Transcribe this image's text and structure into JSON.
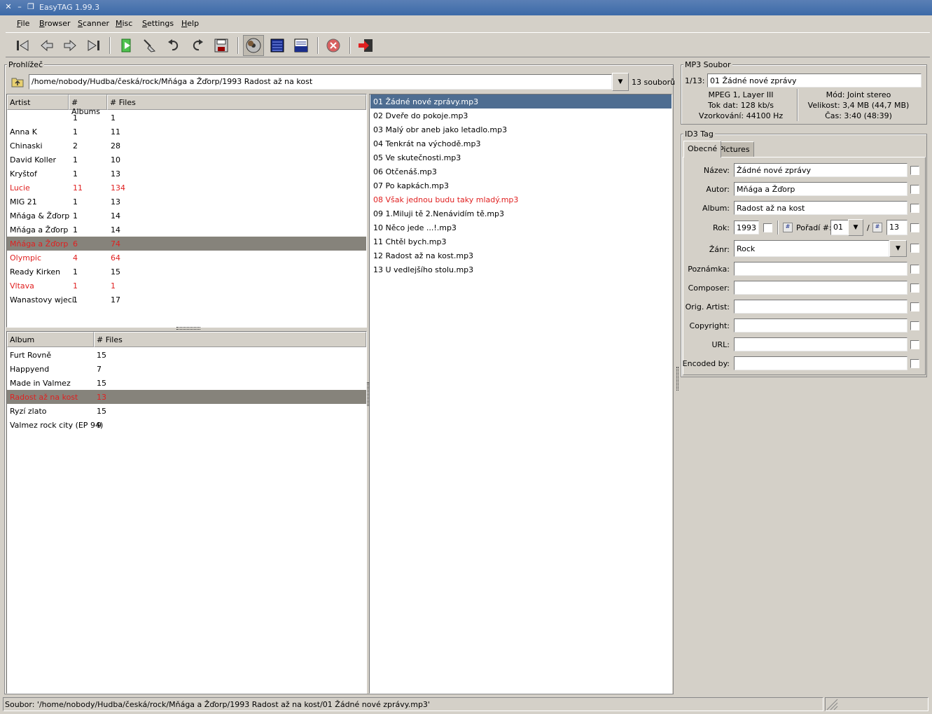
{
  "window": {
    "title": "EasyTAG 1.99.3"
  },
  "menu": [
    "File",
    "Browser",
    "Scanner",
    "Misc",
    "Settings",
    "Help"
  ],
  "browser": {
    "label": "Prohlížeč",
    "path": "/home/nobody/Hudba/česká/rock/Mňága a Žďorp/1993 Radost až na kost",
    "file_count": "13 souborů",
    "artist_headers": [
      "Artist",
      "# Albums",
      "# Files"
    ],
    "artists": [
      {
        "name": "",
        "albums": "1",
        "files": "1"
      },
      {
        "name": "Anna K",
        "albums": "1",
        "files": "11"
      },
      {
        "name": "Chinaski",
        "albums": "2",
        "files": "28"
      },
      {
        "name": "David Koller",
        "albums": "1",
        "files": "10"
      },
      {
        "name": "Kryštof",
        "albums": "1",
        "files": "13"
      },
      {
        "name": "Lucie",
        "albums": "11",
        "files": "134"
      },
      {
        "name": "MIG 21",
        "albums": "1",
        "files": "13"
      },
      {
        "name": "Mňága & Žďorp",
        "albums": "1",
        "files": "14"
      },
      {
        "name": "Mňága a Žďorp",
        "albums": "1",
        "files": "14"
      },
      {
        "name": "Mňága a Žďorp",
        "albums": "6",
        "files": "74"
      },
      {
        "name": "Olympic",
        "albums": "4",
        "files": "64"
      },
      {
        "name": "Ready Kirken",
        "albums": "1",
        "files": "15"
      },
      {
        "name": "Vltava",
        "albums": "1",
        "files": "1"
      },
      {
        "name": "Wanastovy wjeci",
        "albums": "1",
        "files": "17"
      }
    ],
    "album_headers": [
      "Album",
      "# Files"
    ],
    "albums": [
      {
        "name": "Furt Rovně",
        "files": "15"
      },
      {
        "name": "Happyend",
        "files": "7"
      },
      {
        "name": "Made in Valmez",
        "files": "15"
      },
      {
        "name": "Radost až na kost",
        "files": "13"
      },
      {
        "name": "Ryzí zlato",
        "files": "15"
      },
      {
        "name": "Valmez rock city (EP 94)",
        "files": "9"
      }
    ],
    "files": [
      "01 Žádné nové zprávy.mp3",
      "02 Dveře do pokoje.mp3",
      "03 Malý obr aneb jako letadlo.mp3",
      "04 Tenkrát na východě.mp3",
      "05 Ve skutečnosti.mp3",
      "06 Otčenáš.mp3",
      "07 Po kapkách.mp3",
      "08 Však jednou budu taky mladý.mp3",
      "09 1.Miluji tě 2.Nenávidím tě.mp3",
      "10 Něco jede ...!.mp3",
      "11 Chtěl bych.mp3",
      "12 Radost až na kost.mp3",
      "13 U vedlejšího stolu.mp3"
    ]
  },
  "mp3": {
    "label": "MP3 Soubor",
    "index": "1/13:",
    "filename": "01 Žádné nové zprávy",
    "info_left": [
      "MPEG 1, Layer III",
      "Tok dat: 128 kb/s",
      "Vzorkování: 44100 Hz"
    ],
    "info_right": [
      "Mód: Joint stereo",
      "Velikost: 3,4 MB (44,7 MB)",
      "Čas: 3:40 (48:39)"
    ]
  },
  "id3": {
    "label": "ID3 Tag",
    "tabs": [
      "Obecné",
      "Pictures"
    ],
    "fields": [
      {
        "label": "Název:",
        "value": "Žádné nové zprávy"
      },
      {
        "label": "Autor:",
        "value": "Mňága a Žďorp"
      },
      {
        "label": "Album:",
        "value": "Radost až na kost"
      }
    ],
    "rok_label": "Rok:",
    "rok": "1993",
    "track_label": "Pořadí #:",
    "track": "01",
    "track_sep": "/",
    "track_total": "13",
    "genre_label": "Žánr:",
    "genre": "Rock",
    "extra_fields": [
      {
        "label": "Poznámka:",
        "value": ""
      },
      {
        "label": "Composer:",
        "value": ""
      },
      {
        "label": "Orig. Artist:",
        "value": ""
      },
      {
        "label": "Copyright:",
        "value": ""
      },
      {
        "label": "URL:",
        "value": ""
      },
      {
        "label": "Encoded by:",
        "value": ""
      }
    ]
  },
  "status": "Soubor: '/home/nobody/Hudba/česká/rock/Mňága a Žďorp/1993 Radost až na kost/01 Žádné nové zprávy.mp3'",
  "colors": {
    "changed": "#e02020",
    "selection": "#4e6d91",
    "row_selection": "#86837b"
  }
}
